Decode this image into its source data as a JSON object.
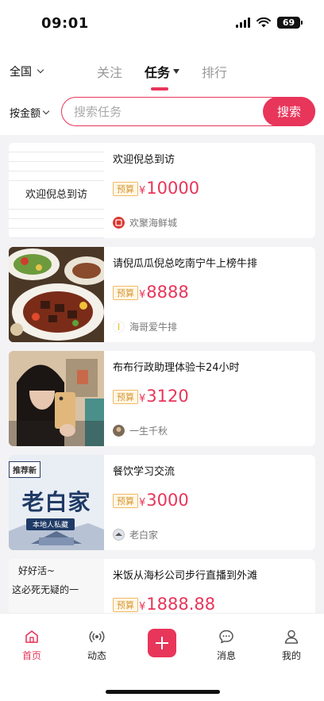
{
  "status_bar": {
    "time": "09:01",
    "battery": "69"
  },
  "header": {
    "region": "全国",
    "tabs": [
      {
        "label": "关注",
        "active": false
      },
      {
        "label": "任务",
        "active": true
      },
      {
        "label": "排行",
        "active": false
      }
    ]
  },
  "search": {
    "sort_label": "按金额",
    "placeholder": "搜索任务",
    "button": "搜索"
  },
  "tasks": [
    {
      "title": "欢迎倪总到访",
      "thumb_text": "欢迎倪总到访",
      "tag": "预算",
      "currency": "¥",
      "amount": "10000",
      "author": "欢聚海鲜城"
    },
    {
      "title": "请倪瓜瓜倪总吃南宁牛上榜牛排",
      "tag": "预算",
      "currency": "¥",
      "amount": "8888",
      "author": "海哥爱牛排"
    },
    {
      "title": "布布行政助理体验卡24小时",
      "tag": "预算",
      "currency": "¥",
      "amount": "3120",
      "author": "一生千秋"
    },
    {
      "title": "餐饮学习交流",
      "thumb_banner": "推荐新",
      "thumb_name": "老白家",
      "thumb_sub": "本地人私藏",
      "tag": "预算",
      "currency": "¥",
      "amount": "3000",
      "author": "老白家"
    },
    {
      "title": "米饭从海杉公司步行直播到外滩",
      "thumb_line1": "好好活~",
      "thumb_line2": "这必死无疑的一",
      "tag": "预算",
      "currency": "¥",
      "amount": "1888.88",
      "author": ""
    }
  ],
  "bottom_nav": {
    "items": [
      {
        "label": "首页",
        "icon": "home-icon",
        "active": true
      },
      {
        "label": "动态",
        "icon": "broadcast-icon",
        "active": false
      },
      {
        "label": "",
        "icon": "plus-icon",
        "active": false
      },
      {
        "label": "消息",
        "icon": "message-icon",
        "active": false
      },
      {
        "label": "我的",
        "icon": "profile-icon",
        "active": false
      }
    ]
  },
  "colors": {
    "accent": "#e8355a",
    "tag_border": "#f0b962",
    "tag_text": "#d89a35",
    "background": "#f3f3f5"
  }
}
